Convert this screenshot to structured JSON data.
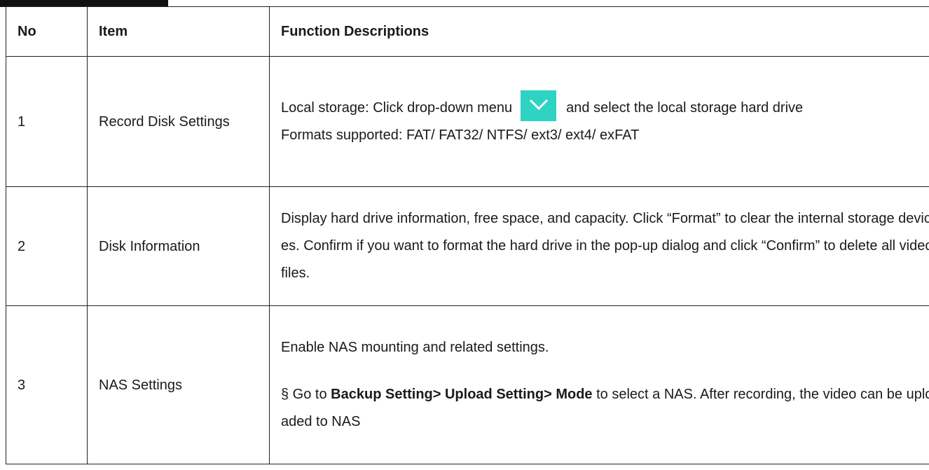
{
  "table": {
    "headers": {
      "no": "No",
      "item": "Item",
      "description": "Function Descriptions"
    },
    "rows": [
      {
        "no": "1",
        "item": "Record Disk Settings",
        "desc_part1": "Local storage: Click drop-down menu",
        "desc_part2": "and select the local storage hard drive",
        "desc_line2": "Formats supported: FAT/ FAT32/ NTFS/ ext3/ ext4/ exFAT",
        "icon": "chevron-down-icon",
        "icon_color": "#2fd3c3"
      },
      {
        "no": "2",
        "item": "Disk Information",
        "description": "Display hard drive information, free space, and capacity. Click “Format” to clear the internal storage devices. Confirm if you want to format the hard drive in the pop-up dialog and click “Confirm” to delete all video files."
      },
      {
        "no": "3",
        "item": "NAS Settings",
        "desc_line1": "Enable NAS mounting and related settings.",
        "desc_prefix": "§ Go to",
        "desc_bold": "Backup Setting> Upload Setting> Mode",
        "desc_suffix": "to select a NAS. After recording, the video can be uploaded to NAS"
      }
    ]
  }
}
